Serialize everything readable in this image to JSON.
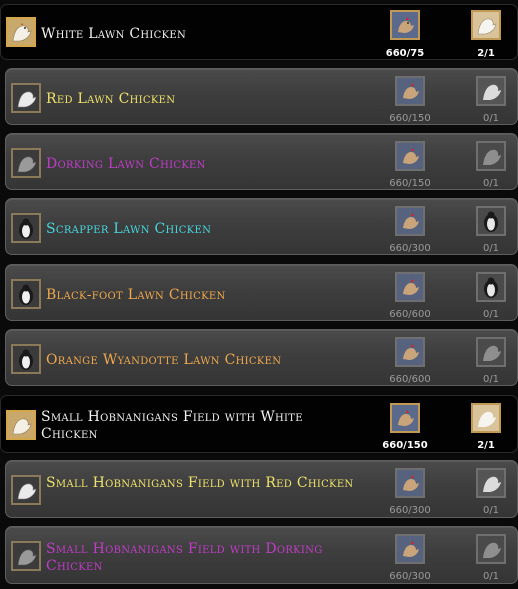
{
  "colors": {
    "white": "#f2f2f2",
    "yellow": "#f0e36a",
    "purple": "#c23cc9",
    "cyan": "#47d7de",
    "orange": "#f0a94e"
  },
  "rows": [
    {
      "name": "White Lawn Chicken",
      "color": "white",
      "recipe_icon": "rooster-recipe-icon",
      "item_icon": "white-chicken-icon",
      "recipe_count": "660/75",
      "item_count": "2/1",
      "selected": true
    },
    {
      "name": "Red Lawn Chicken",
      "color": "yellow",
      "recipe_icon": "rooster-recipe-icon",
      "item_icon": "white-chicken-icon",
      "recipe_count": "660/150",
      "item_count": "0/1",
      "selected": false
    },
    {
      "name": "Dorking Lawn Chicken",
      "color": "purple",
      "recipe_icon": "rooster-recipe-icon",
      "item_icon": "grey-chicken-icon",
      "recipe_count": "660/150",
      "item_count": "0/1",
      "selected": false
    },
    {
      "name": "Scrapper Lawn Chicken",
      "color": "cyan",
      "recipe_icon": "rooster-recipe-icon",
      "item_icon": "penguin-chicken-icon",
      "recipe_count": "660/300",
      "item_count": "0/1",
      "selected": false
    },
    {
      "name": "Black-foot Lawn Chicken",
      "color": "orange",
      "recipe_icon": "rooster-recipe-icon",
      "item_icon": "penguin-chicken-icon",
      "recipe_count": "660/600",
      "item_count": "0/1",
      "selected": false
    },
    {
      "name": "Orange Wyandotte Lawn Chicken",
      "color": "orange",
      "recipe_icon": "rooster-recipe-icon",
      "item_icon": "grey-chicken-icon",
      "recipe_count": "660/600",
      "item_count": "0/1",
      "selected": false
    },
    {
      "name": "Small Hobnanigans Field with White Chicken",
      "color": "white",
      "recipe_icon": "rooster-recipe-icon",
      "item_icon": "white-chicken-icon",
      "recipe_count": "660/150",
      "item_count": "2/1",
      "selected": true
    },
    {
      "name": "Small Hobnanigans Field with Red Chicken",
      "color": "yellow",
      "recipe_icon": "rooster-recipe-icon",
      "item_icon": "white-chicken-icon",
      "recipe_count": "660/300",
      "item_count": "0/1",
      "selected": false
    },
    {
      "name": "Small Hobnanigans Field with Dorking Chicken",
      "color": "purple",
      "recipe_icon": "rooster-recipe-icon",
      "item_icon": "grey-chicken-icon",
      "recipe_count": "660/300",
      "item_count": "0/1",
      "selected": false
    }
  ]
}
